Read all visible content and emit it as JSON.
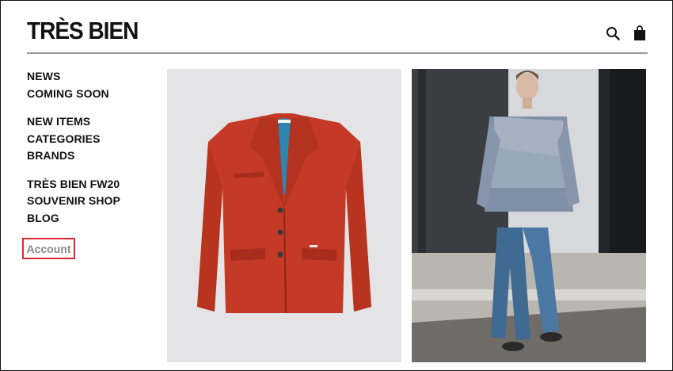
{
  "header": {
    "logo": "TRÈS BIEN",
    "icons": [
      "search-icon",
      "bag-icon"
    ]
  },
  "nav": {
    "groups": [
      [
        "NEWS",
        "COMING SOON"
      ],
      [
        "NEW ITEMS",
        "CATEGORIES",
        "BRANDS"
      ],
      [
        "TRÈS BIEN FW20",
        "SOUVENIR SHOP",
        "BLOG"
      ]
    ],
    "account": "Account"
  },
  "tiles": [
    {
      "name": "product-image-red-blazer"
    },
    {
      "name": "runway-image-model"
    }
  ],
  "colors": {
    "text": "#111111",
    "rule": "#9a9a9a",
    "highlight": "#e0282e",
    "account_text": "#8a8a8a",
    "blazer": "#c53a26"
  }
}
